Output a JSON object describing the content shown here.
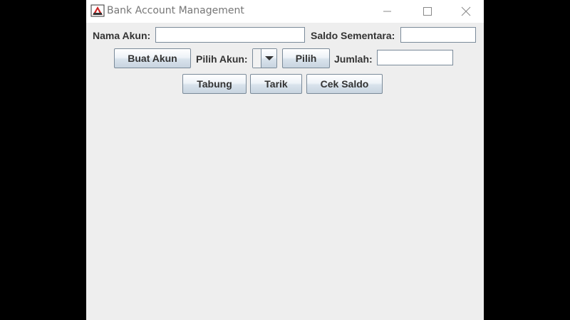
{
  "window": {
    "title": "Bank Account Management",
    "controls": {
      "minimize_icon": "minimize-icon",
      "maximize_icon": "maximize-icon",
      "close_icon": "close-icon"
    }
  },
  "row1": {
    "nama_akun_label": "Nama Akun:",
    "nama_akun_value": "",
    "saldo_sementara_label": "Saldo Sementara:",
    "saldo_sementara_value": ""
  },
  "row2": {
    "buat_akun_label": "Buat Akun",
    "pilih_akun_label": "Pilih Akun:",
    "pilih_akun_selected": "",
    "pilih_label": "Pilih",
    "jumlah_label": "Jumlah:",
    "jumlah_value": ""
  },
  "row3": {
    "tabung_label": "Tabung",
    "tarik_label": "Tarik",
    "cek_saldo_label": "Cek Saldo"
  },
  "colors": {
    "window_bg": "#eeeeee",
    "titlebar_bg": "#ffffff",
    "outer_bg": "#000000",
    "label_text": "#333333",
    "title_text": "#767676",
    "border": "#7a8a99"
  }
}
